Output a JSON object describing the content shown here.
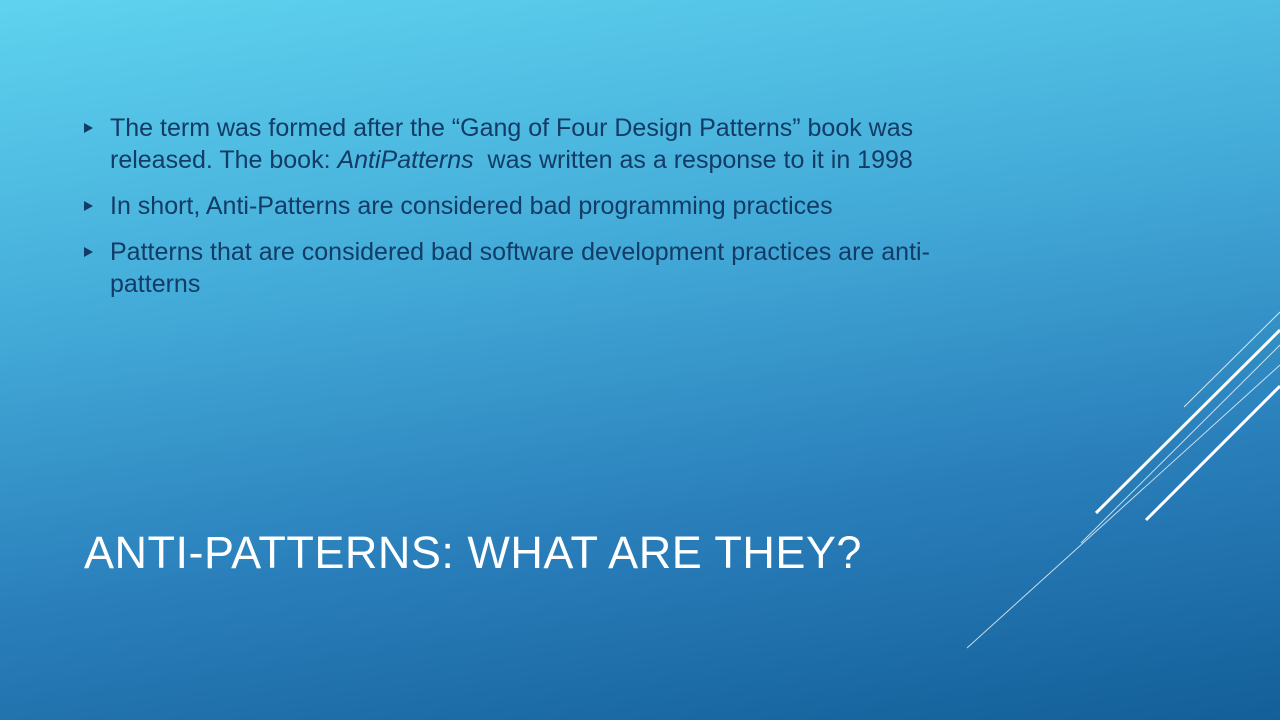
{
  "slide": {
    "title": "ANTI-PATTERNS: WHAT ARE THEY?",
    "bullets": [
      {
        "before": "The term was formed after the “Gang of Four Design Patterns” book was released. The book: ",
        "emphasis": "AntiPatterns",
        "after": "  was written as a response to it in 1998"
      },
      {
        "text": "In short, Anti-Patterns are considered bad programming practices"
      },
      {
        "text": "Patterns that are considered bad software development practices are anti-patterns"
      }
    ],
    "bullet_icon": "triangle-right-icon",
    "decoration": "diagonal-lines"
  },
  "colors": {
    "background_top": "#5fd3ef",
    "background_bottom": "#135f99",
    "body_text": "#123b66",
    "title_text": "#ffffff"
  }
}
